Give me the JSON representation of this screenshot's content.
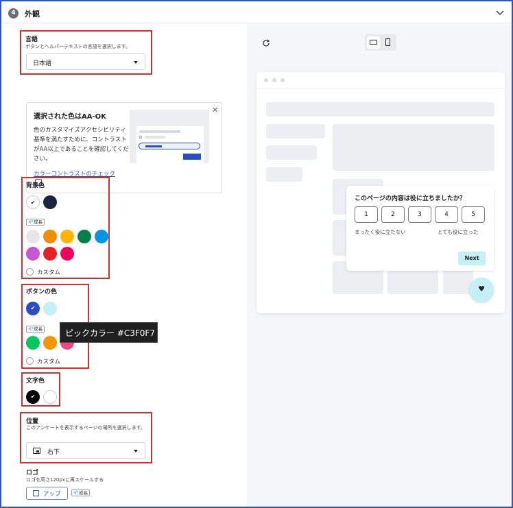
{
  "header": {
    "step": "4",
    "title": "外観"
  },
  "language": {
    "label": "言語",
    "help": "ボタンとヘルパーテキストの言語を選択します。",
    "value": "日本語"
  },
  "contrast_card": {
    "title": "選択された色はAA-OK",
    "body": "色のカスタマイズアクセシビリティ基準を満たすために、コントラストがAA以上であることを確認してください。",
    "link": "カラーコントラストのチェック",
    "close": "✕"
  },
  "background": {
    "label": "背景色",
    "badge": "成長",
    "custom": "カスタム"
  },
  "button_color": {
    "label": "ボタンの色",
    "badge": "成長",
    "custom": "カスタム"
  },
  "tooltip": {
    "text": "ピックカラー #C3F0F7"
  },
  "text_color": {
    "label": "文字色"
  },
  "position": {
    "label": "位置",
    "help": "このアンケートを表示するページの場所を選択します。",
    "value": "右下"
  },
  "logo": {
    "label": "ロゴ",
    "help": "ロゴを高さ120pxに再スケールする",
    "upload": "アップ",
    "badge": "成長"
  },
  "preview": {
    "question": "このページの内容は役に立ちましたか？",
    "scale": [
      "1",
      "2",
      "3",
      "4",
      "5"
    ],
    "low_label": "まったく役に立たない",
    "high_label": "とても役に立った",
    "next": "Next",
    "fab_icon": "♥"
  },
  "colors": {
    "background_swatches": [
      "#ffffff",
      "#1c2440"
    ],
    "background_growth_swatches": [
      "#e6e6e6",
      "#f28c00",
      "#ffb400",
      "#00804a",
      "#0096e6",
      "#c855d2",
      "#e61e28",
      "#f0005a"
    ],
    "button_swatches": [
      "#2b4cc4",
      "#c3f0f7"
    ],
    "button_growth_swatches": [
      "#00c85a",
      "#f59600",
      "#f04682"
    ],
    "text_swatches": [
      "#000000",
      "#ffffff"
    ],
    "accent": "#c3f0f7",
    "frame": "#2a56b8",
    "annotation": "#d32f2f"
  }
}
